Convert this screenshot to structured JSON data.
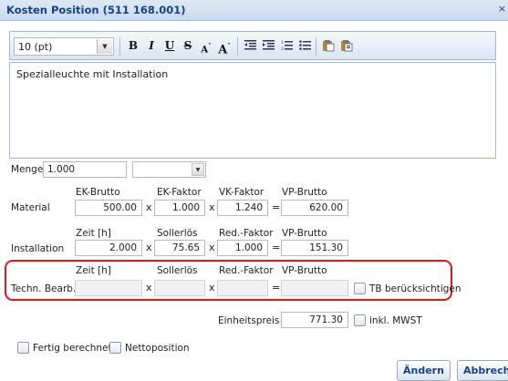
{
  "window": {
    "title": "Kosten Position (511 168.001)",
    "close_glyph": "×"
  },
  "editor": {
    "font_size": "10 (pt)",
    "tools": [
      "bold-icon",
      "italic-icon",
      "underline-icon",
      "strikethrough-icon",
      "superscript-icon",
      "increase-font-icon",
      "decrease-indent-icon",
      "increase-indent-icon",
      "ordered-list-icon",
      "unordered-list-icon",
      "paste-icon",
      "paste-special-icon"
    ],
    "text": "Spezialleuchte mit Installation"
  },
  "menge": {
    "label": "Menge",
    "value": "1.000",
    "unit": ""
  },
  "material": {
    "label": "Material",
    "headers": [
      "EK-Brutto",
      "EK-Faktor",
      "VK-Faktor",
      "VP-Brutto"
    ],
    "values": [
      "500.00",
      "1.000",
      "1.240",
      "620.00"
    ]
  },
  "installation": {
    "label": "Installation",
    "headers": [
      "Zeit [h]",
      "Sollerlös",
      "Red.-Faktor",
      "VP-Brutto"
    ],
    "values": [
      "2.000",
      "75.65",
      "1.000",
      "151.30"
    ]
  },
  "techn": {
    "label": "Techn. Bearb.",
    "headers": [
      "Zeit [h]",
      "Sollerlös",
      "Red.-Faktor",
      "VP-Brutto"
    ],
    "values": [
      "",
      "",
      "",
      ""
    ],
    "tb_checkbox": "TB berücksichtigen"
  },
  "operators": {
    "times": "x",
    "equals": "="
  },
  "einheitspreis": {
    "label": "Einheitspreis",
    "value": "771.30",
    "mwst_checkbox": "inkl. MWST"
  },
  "footer": {
    "fertig": "Fertig berechnet",
    "netto": "Nettoposition",
    "aendern": "Ändern",
    "abbrechen": "Abbrechen"
  },
  "colors": {
    "title": "#15428b",
    "highlight": "#e0151d",
    "border": "#99bbe8"
  }
}
